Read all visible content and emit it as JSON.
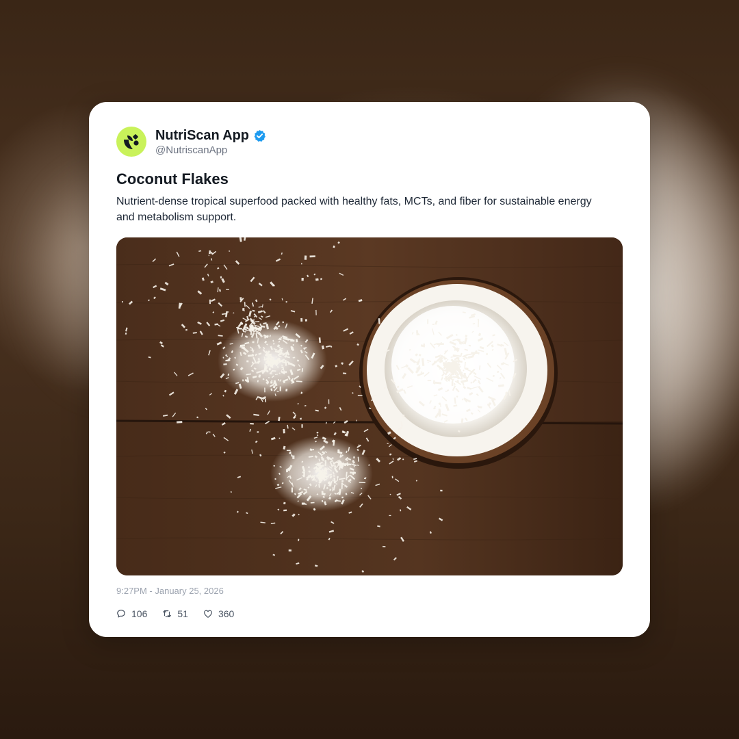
{
  "post": {
    "author": {
      "display_name": "NutriScan App",
      "handle": "@NutriscanApp",
      "verified": true,
      "avatar_icon": "nutriscan-logo-icon",
      "avatar_color": "#c9f25a"
    },
    "title": "Coconut Flakes",
    "description": "Nutrient-dense tropical superfood packed with healthy fats, MCTs, and fiber for sustainable energy and metabolism support.",
    "image_subject": "coconut-flakes-photo",
    "timestamp": "9:27PM - January 25, 2026",
    "stats": {
      "replies": "106",
      "reposts": "51",
      "likes": "360"
    }
  },
  "icons": {
    "verified": "verified-badge-icon",
    "reply": "comment-icon",
    "repost": "repost-icon",
    "like": "heart-icon"
  },
  "colors": {
    "verified_blue": "#1d9bf0",
    "text_primary": "#141a22",
    "text_secondary": "#6b7280",
    "card_background": "#ffffff"
  }
}
